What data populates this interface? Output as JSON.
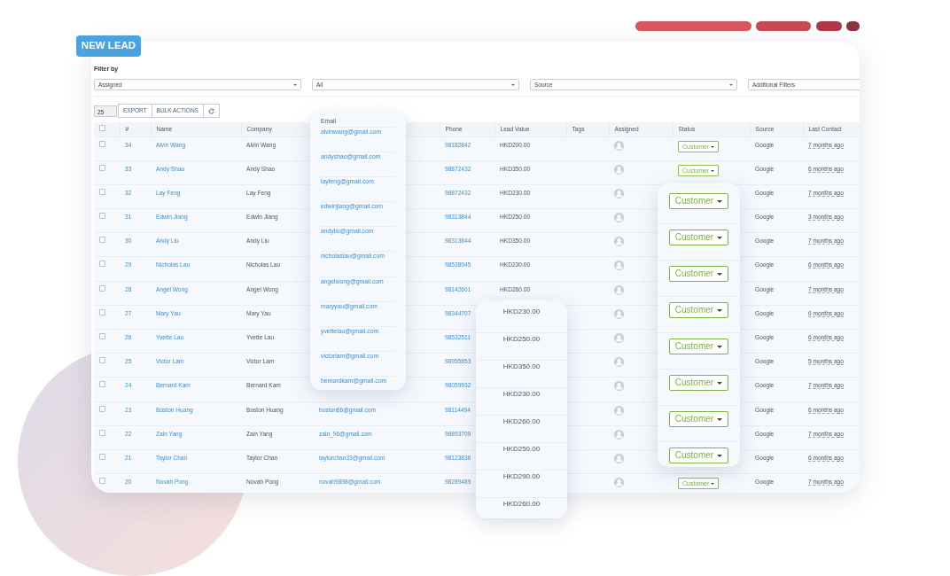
{
  "new_lead_button": "NEW LEAD",
  "filters": {
    "label": "Filter by",
    "selects": [
      {
        "value": "Assigned"
      },
      {
        "value": "All"
      },
      {
        "value": "Source"
      },
      {
        "value": "Additional Filters"
      }
    ]
  },
  "toolbar": {
    "page_size": "25",
    "buttons": [
      "EXPORT",
      "BULK ACTIONS"
    ]
  },
  "table": {
    "select_all_checked": false,
    "columns": [
      "#",
      "Name",
      "Company",
      "Phone",
      "Lead Value",
      "Tags",
      "Assigned",
      "Status",
      "Source",
      "Last Contact"
    ],
    "rows": [
      {
        "checked": false,
        "id": "34",
        "name": "Alvin Wang",
        "company": "Alvin Wang",
        "phone": "98182842",
        "lead_value": "HKD200.00",
        "status": "Customer",
        "source": "Google",
        "last_contact": "7 months ago"
      },
      {
        "checked": false,
        "id": "33",
        "name": "Andy Shao",
        "company": "Andy Shao",
        "phone": "98872432",
        "lead_value": "HKD350.00",
        "status": "Customer",
        "source": "Google",
        "last_contact": "6 months ago"
      },
      {
        "checked": false,
        "id": "32",
        "name": "Lay Feng",
        "company": "Lay Feng",
        "phone": "98872432",
        "lead_value": "HKD230.00",
        "source": "Google",
        "last_contact": "7 months ago"
      },
      {
        "checked": false,
        "id": "31",
        "name": "Edwin Jiang",
        "company": "Edwin Jiang",
        "phone": "98313844",
        "lead_value": "HKD250.00",
        "source": "Google",
        "last_contact": "3 months ago"
      },
      {
        "checked": false,
        "id": "30",
        "name": "Andy Liu",
        "company": "Andy Liu",
        "phone": "98313844",
        "lead_value": "HKD350.00",
        "source": "Google",
        "last_contact": "7 months ago"
      },
      {
        "checked": false,
        "id": "29",
        "name": "Nicholas Lau",
        "company": "Nicholas Lau",
        "phone": "98538945",
        "lead_value": "HKD230.00",
        "source": "Google",
        "last_contact": "6 months ago"
      },
      {
        "checked": false,
        "id": "28",
        "name": "Angel Wong",
        "company": "Angel Wong",
        "phone": "98142601",
        "lead_value": "HKD260.00",
        "source": "Google",
        "last_contact": "7 months ago"
      },
      {
        "checked": false,
        "id": "27",
        "name": "Mary Yau",
        "company": "Mary Yau",
        "phone": "98344707",
        "source": "Google",
        "last_contact": "6 months ago"
      },
      {
        "checked": false,
        "id": "26",
        "name": "Yvette Lau",
        "company": "Yvette Lau",
        "phone": "98532511",
        "source": "Google",
        "last_contact": "6 months ago"
      },
      {
        "checked": false,
        "id": "25",
        "name": "Victor Lam",
        "company": "Victor Lam",
        "phone": "98955853",
        "source": "Google",
        "last_contact": "5 months ago"
      },
      {
        "checked": false,
        "id": "24",
        "name": "Bernard Kam",
        "company": "Bernard Kam",
        "phone": "98059932",
        "source": "Google",
        "last_contact": "7 months ago"
      },
      {
        "checked": false,
        "id": "23",
        "name": "Boston Huang",
        "company": "Boston Huang",
        "email": "boston66@gmail.com",
        "phone": "98114494",
        "source": "Google",
        "last_contact": "6 months ago"
      },
      {
        "checked": false,
        "id": "22",
        "name": "Zain Yang",
        "company": "Zain Yang",
        "email": "zain_96@gmail.com",
        "phone": "98893709",
        "source": "Google",
        "last_contact": "7 months ago"
      },
      {
        "checked": false,
        "id": "21",
        "name": "Taylor Chan",
        "company": "Taylor Chan",
        "email": "taylorchan33@gmail.com",
        "phone": "98123836",
        "source": "Google",
        "last_contact": "6 months ago"
      },
      {
        "checked": false,
        "id": "20",
        "name": "Novah Pong",
        "company": "Novah Pong",
        "email": "novah9898@gmail.com",
        "phone": "98289489",
        "status": "Customer",
        "source": "Google",
        "last_contact": "7 months ago"
      }
    ]
  },
  "email_card": {
    "header": "Email",
    "emails": [
      "alvinwang@gmail.com",
      "andyshao@gmail.com",
      "layfeng@gmail.com",
      "edwinjiang@gmail.com",
      "andyliu@gmail.com",
      "nicholaslau@gmail.com",
      "angelwong@gmail.com",
      "maryyau@gmail.com",
      "yvettelau@gmail.com",
      "victorlam@gmail.com",
      "bernardkam@gmail.com"
    ]
  },
  "lead_value_card": {
    "values": [
      "HKD230.00",
      "HKD250.00",
      "HKD350.00",
      "HKD230.00",
      "HKD260.00",
      "HKD250.00",
      "HKD290.00",
      "HKD260.00"
    ]
  },
  "status_card": {
    "buttons": [
      "Customer",
      "Customer",
      "Customer",
      "Customer",
      "Customer",
      "Customer",
      "Customer",
      "Customer"
    ]
  }
}
